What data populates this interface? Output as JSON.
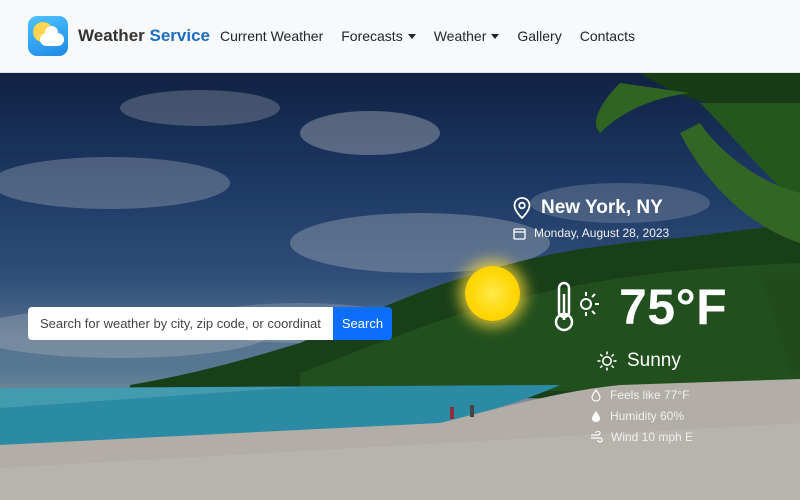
{
  "brand": {
    "name": "Weather",
    "accent": "Service"
  },
  "nav": {
    "items": [
      {
        "label": "Current Weather",
        "dropdown": false
      },
      {
        "label": "Forecasts",
        "dropdown": true
      },
      {
        "label": "Weather",
        "dropdown": true
      },
      {
        "label": "Gallery",
        "dropdown": false
      },
      {
        "label": "Contacts",
        "dropdown": false
      }
    ]
  },
  "search": {
    "placeholder": "Search for weather by city, zip code, or coordinates",
    "button_label": "Search"
  },
  "weather": {
    "location": "New York, NY",
    "date": "Monday, August 28, 2023",
    "temperature": "75°F",
    "condition": "Sunny",
    "feels_like": "Feels like 77°F",
    "humidity": "Humidity 60%",
    "wind": "Wind 10 mph E"
  },
  "colors": {
    "accent": "#1b6ec2",
    "button": "#0d6efd",
    "navbar_bg": "#f8f9fa"
  },
  "icons": [
    "location-pin-icon",
    "calendar-icon",
    "thermometer-sun-icon",
    "sun-icon",
    "droplet-icon",
    "humidity-icon",
    "wind-icon"
  ]
}
